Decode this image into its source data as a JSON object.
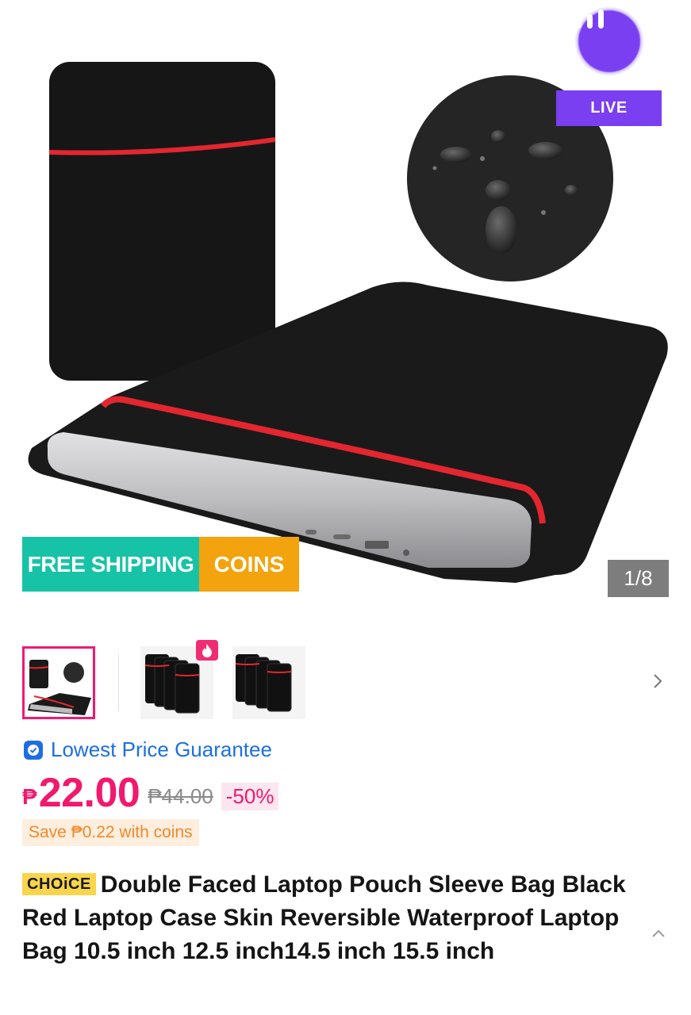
{
  "live": {
    "label": "LIVE",
    "icon": "audio-bars-icon"
  },
  "badges": {
    "free_shipping": "FREE SHIPPING",
    "coins": "COINS"
  },
  "gallery": {
    "counter": "1/8"
  },
  "guarantee": {
    "label": "Lowest Price Guarantee",
    "icon": "check-shield-icon"
  },
  "price": {
    "currency": "₱",
    "current": "22.00",
    "original": "₱44.00",
    "discount": "-50%"
  },
  "coins_save": "Save ₱0.22 with coins",
  "product": {
    "choice_tag": "CHOiCE",
    "title": "Double Faced Laptop Pouch Sleeve Bag Black Red Laptop Case Skin Reversible Waterproof Laptop Bag 10.5 inch 12.5 inch14.5 inch 15.5 inch"
  },
  "colors": {
    "brand_pink": "#f0196e",
    "live_purple": "#7a3ff0",
    "free_shipping": "#16c3a6",
    "coins": "#f3a30d",
    "guarantee_blue": "#1d6fe0"
  }
}
